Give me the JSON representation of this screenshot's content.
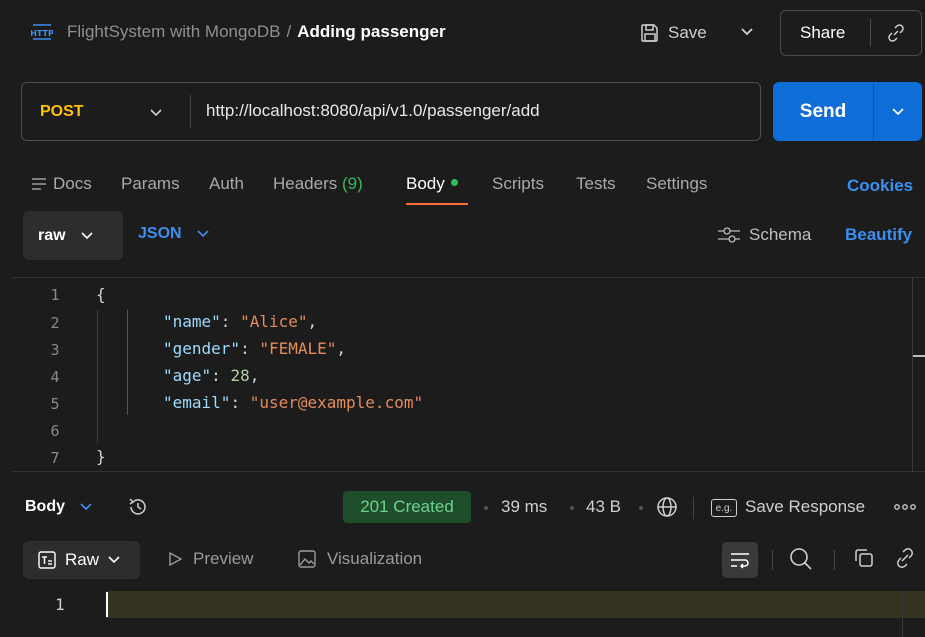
{
  "header": {
    "collection": "FlightSystem with MongoDB",
    "separator": "/",
    "request_name": "Adding passenger",
    "save_label": "Save",
    "share_label": "Share"
  },
  "request": {
    "method": "POST",
    "url": "http://localhost:8080/api/v1.0/passenger/add",
    "send_label": "Send"
  },
  "tabs": {
    "docs": "Docs",
    "params": "Params",
    "auth": "Auth",
    "headers": "Headers",
    "headers_count": "(9)",
    "body": "Body",
    "scripts": "Scripts",
    "tests": "Tests",
    "settings": "Settings",
    "cookies": "Cookies"
  },
  "body_toolbar": {
    "mode": "raw",
    "format": "JSON",
    "schema": "Schema",
    "beautify": "Beautify"
  },
  "editor": {
    "line_numbers": [
      "1",
      "2",
      "3",
      "4",
      "5",
      "6",
      "7"
    ],
    "open_brace": "{",
    "close_brace": "}",
    "fields": [
      {
        "key": "\"name\"",
        "value": "\"Alice\"",
        "comma": ","
      },
      {
        "key": "\"gender\"",
        "value": "\"FEMALE\"",
        "comma": ","
      },
      {
        "key": "\"age\"",
        "value": "28",
        "comma": ","
      },
      {
        "key": "\"email\"",
        "value": "\"user@example.com\"",
        "comma": ""
      }
    ],
    "colon": ": "
  },
  "response": {
    "body_label": "Body",
    "status": "201 Created",
    "time": "39 ms",
    "size": "43 B",
    "eg_label": "e.g.",
    "save_response": "Save Response",
    "view_mode": "Raw",
    "preview": "Preview",
    "visualization": "Visualization",
    "line_number": "1"
  },
  "colors": {
    "accent_orange": "#ff6c37",
    "send_blue": "#0f6dd7",
    "link_blue": "#3b8ff0",
    "method_yellow": "#ffc107",
    "success_green": "#2ebd59"
  }
}
